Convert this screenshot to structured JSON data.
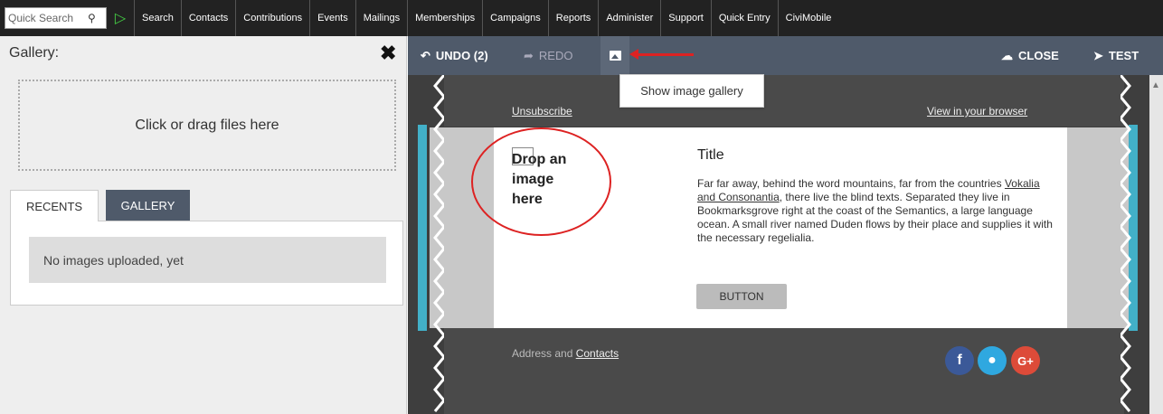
{
  "topnav": {
    "search_placeholder": "Quick Search",
    "items": [
      "Search",
      "Contacts",
      "Contributions",
      "Events",
      "Mailings",
      "Memberships",
      "Campaigns",
      "Reports",
      "Administer",
      "Support",
      "Quick Entry",
      "CiviMobile"
    ]
  },
  "gallery": {
    "title": "Gallery:",
    "dropzone_text": "Click or drag files here",
    "tabs": [
      "RECENTS",
      "GALLERY"
    ],
    "empty_text": "No images uploaded, yet"
  },
  "toolbar": {
    "undo_label": "UNDO (2)",
    "redo_label": "REDO",
    "close_label": "CLOSE",
    "test_label": "TEST",
    "tooltip": "Show image gallery"
  },
  "template": {
    "unsubscribe": "Unsubscribe",
    "view_in_browser": "View in your browser",
    "drop_image": "Drop an image here",
    "title": "Title",
    "body_before": "Far far away, behind the word mountains, far from the countries ",
    "body_link": "Vokalia and Consonantia",
    "body_after": ", there live the blind texts. Separated they live in Bookmarksgrove right at the coast of the Semantics, a large language ocean. A small river named Duden flows by their place and supplies it with the necessary regelialia.",
    "button": "BUTTON",
    "address_text": "Address and ",
    "contacts_link": "Contacts"
  },
  "icons": {
    "search": "search-icon",
    "play": "play-icon",
    "close": "close-x-icon",
    "undo": "undo-icon",
    "redo": "redo-icon",
    "image": "image-icon",
    "cloud": "cloud-upload-icon",
    "send": "send-icon",
    "facebook": "facebook-icon",
    "twitter": "twitter-icon",
    "googleplus": "google-plus-icon"
  },
  "colors": {
    "topnav_bg": "#222222",
    "toolbar_bg": "#4f5a6a",
    "accent_red": "#dd2222",
    "accent_blue": "#42b0c8"
  }
}
